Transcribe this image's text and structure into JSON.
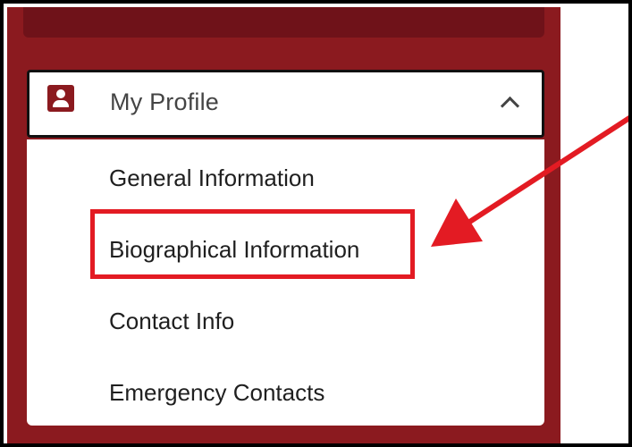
{
  "menu": {
    "title": "My Profile",
    "icon": "profile-icon",
    "expanded": true,
    "items": [
      {
        "label": "General Information"
      },
      {
        "label": "Biographical Information"
      },
      {
        "label": "Contact Info"
      },
      {
        "label": "Emergency Contacts"
      }
    ]
  },
  "annotation": {
    "highlighted_item": "Biographical Information",
    "color": "#e31b23"
  },
  "colors": {
    "sidebar": "#8b1a1f",
    "header_border": "#111111",
    "text": "#1f1f1f"
  }
}
